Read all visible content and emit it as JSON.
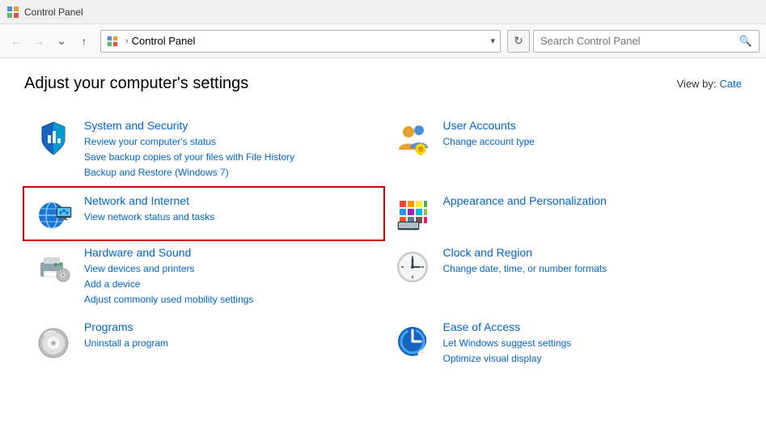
{
  "titleBar": {
    "icon": "control-panel-icon",
    "title": "Control Panel"
  },
  "navBar": {
    "backLabel": "←",
    "forwardLabel": "→",
    "upLabel": "↑",
    "addressPath": "Control Panel",
    "searchPlaceholder": "Search Control Panel",
    "refreshLabel": "↻"
  },
  "main": {
    "pageTitle": "Adjust your computer's settings",
    "viewBy": {
      "label": "View by:",
      "value": "Cate"
    },
    "categories": [
      {
        "id": "system-security",
        "title": "System and Security",
        "links": [
          "Review your computer's status",
          "Save backup copies of your files with File History",
          "Backup and Restore (Windows 7)"
        ],
        "highlighted": false
      },
      {
        "id": "user-accounts",
        "title": "User Accounts",
        "links": [
          "Change account type"
        ],
        "highlighted": false
      },
      {
        "id": "network-internet",
        "title": "Network and Internet",
        "links": [
          "View network status and tasks"
        ],
        "highlighted": true
      },
      {
        "id": "appearance-personalization",
        "title": "Appearance and Personalization",
        "links": [],
        "highlighted": false
      },
      {
        "id": "hardware-sound",
        "title": "Hardware and Sound",
        "links": [
          "View devices and printers",
          "Add a device",
          "Adjust commonly used mobility settings"
        ],
        "highlighted": false
      },
      {
        "id": "clock-region",
        "title": "Clock and Region",
        "links": [
          "Change date, time, or number formats"
        ],
        "highlighted": false
      },
      {
        "id": "programs",
        "title": "Programs",
        "links": [
          "Uninstall a program"
        ],
        "highlighted": false
      },
      {
        "id": "ease-of-access",
        "title": "Ease of Access",
        "links": [
          "Let Windows suggest settings",
          "Optimize visual display"
        ],
        "highlighted": false
      }
    ]
  }
}
